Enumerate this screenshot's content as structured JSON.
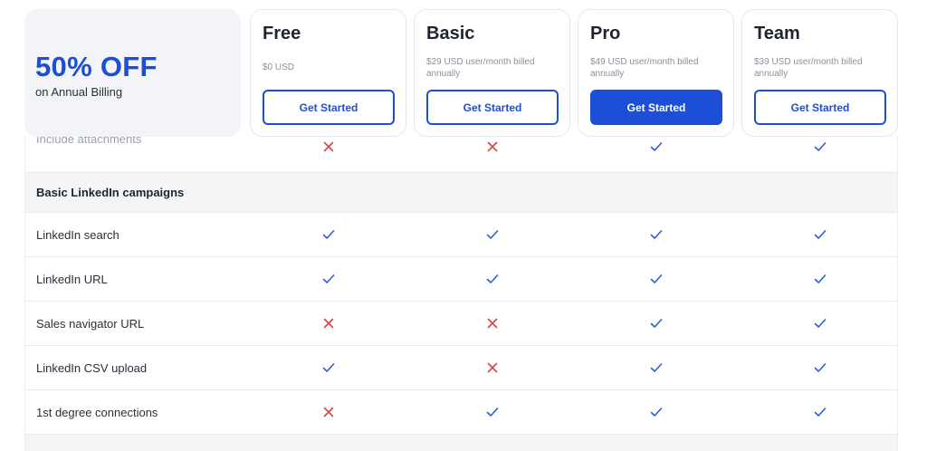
{
  "colors": {
    "accent": "#1d4ed8",
    "check": "#2c5fd4",
    "cross": "#d64545",
    "section_bg": "#f4f5f7"
  },
  "promo": {
    "title": "50% OFF",
    "subtitle": "on Annual Billing"
  },
  "plans": [
    {
      "name": "Free",
      "price": "$0 USD",
      "cta": "Get Started",
      "highlighted": false
    },
    {
      "name": "Basic",
      "price": "$29 USD user/month billed annually",
      "cta": "Get Started",
      "highlighted": false
    },
    {
      "name": "Pro",
      "price": "$49 USD user/month billed annually",
      "cta": "Get Started",
      "highlighted": true
    },
    {
      "name": "Team",
      "price": "$39 USD user/month billed annually",
      "cta": "Get Started",
      "highlighted": false
    }
  ],
  "table": {
    "partial_row": {
      "label": "Include attachments",
      "values": [
        "cross",
        "cross",
        "check",
        "check"
      ]
    },
    "section": {
      "title": "Basic LinkedIn campaigns"
    },
    "rows": [
      {
        "label": "LinkedIn search",
        "values": [
          "check",
          "check",
          "check",
          "check"
        ]
      },
      {
        "label": "LinkedIn URL",
        "values": [
          "check",
          "check",
          "check",
          "check"
        ]
      },
      {
        "label": "Sales navigator URL",
        "values": [
          "cross",
          "cross",
          "check",
          "check"
        ]
      },
      {
        "label": "LinkedIn CSV upload",
        "values": [
          "check",
          "cross",
          "check",
          "check"
        ]
      },
      {
        "label": "1st degree connections",
        "values": [
          "cross",
          "check",
          "check",
          "check"
        ]
      }
    ]
  }
}
